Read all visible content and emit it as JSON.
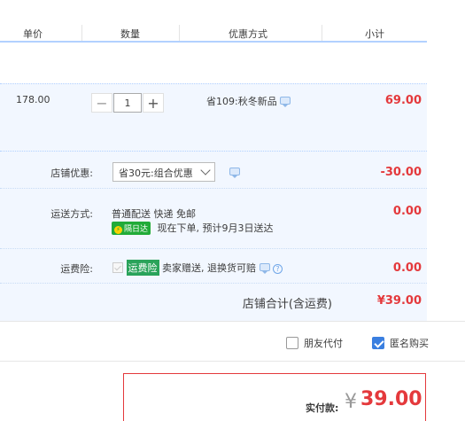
{
  "header": {
    "col_price": "单价",
    "col_qty": "数量",
    "col_promo": "优惠方式",
    "col_subtotal": "小计"
  },
  "item": {
    "price": "178.00",
    "quantity": "1",
    "minus": "−",
    "plus": "+",
    "promo": "省109:秋冬新品",
    "subtotal": "69.00"
  },
  "shop": {
    "discount_label": "店铺优惠:",
    "discount_select": "省30元:组合优惠",
    "discount_amount": "-30.00",
    "shipping_label": "运送方式:",
    "shipping_method": "普通配送 快递 免邮",
    "shipping_tag": "隔日达",
    "shipping_eta": "现在下单, 预计9月3日送达",
    "shipping_amount": "0.00",
    "insurance_label": "运费险:",
    "insurance_tag": "运费险",
    "insurance_desc": "卖家赠送, 退换货可赔",
    "insurance_amount": "0.00",
    "total_label": "店铺合计(含运费)",
    "total_amount": "¥39.00"
  },
  "options": {
    "friend_pay": "朋友代付",
    "friend_pay_checked": false,
    "anonymous": "匿名购买",
    "anonymous_checked": true
  },
  "payment": {
    "label": "实付款:",
    "currency": "¥",
    "amount": "39.00"
  },
  "colors": {
    "accent_red": "#e4393c",
    "highlight_bg": "#f2f7ff",
    "checkbox_blue": "#3a7fe0",
    "tag_green": "#22ab38"
  }
}
